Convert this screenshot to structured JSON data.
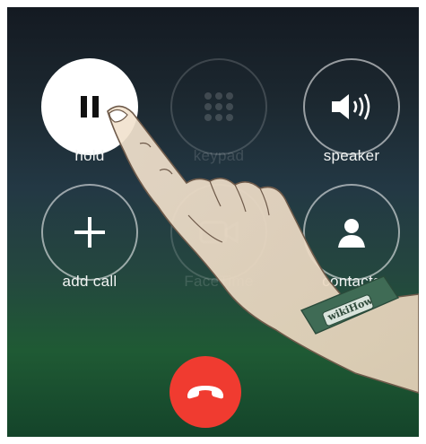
{
  "call_controls": [
    {
      "key": "hold",
      "label": "hold",
      "state": "active"
    },
    {
      "key": "keypad",
      "label": "keypad",
      "state": "disabled"
    },
    {
      "key": "speaker",
      "label": "speaker",
      "state": "normal"
    },
    {
      "key": "add_call",
      "label": "add call",
      "state": "normal"
    },
    {
      "key": "facetime",
      "label": "FaceTime",
      "state": "disabled"
    },
    {
      "key": "contacts",
      "label": "contacts",
      "state": "normal"
    }
  ],
  "end_call": {
    "icon": "phone-hangup-icon",
    "color": "#f03b30"
  },
  "overlay": {
    "wristband_text": "wikiHow"
  },
  "colors": {
    "active_button": "#ffffff",
    "end_call": "#f03b30"
  }
}
